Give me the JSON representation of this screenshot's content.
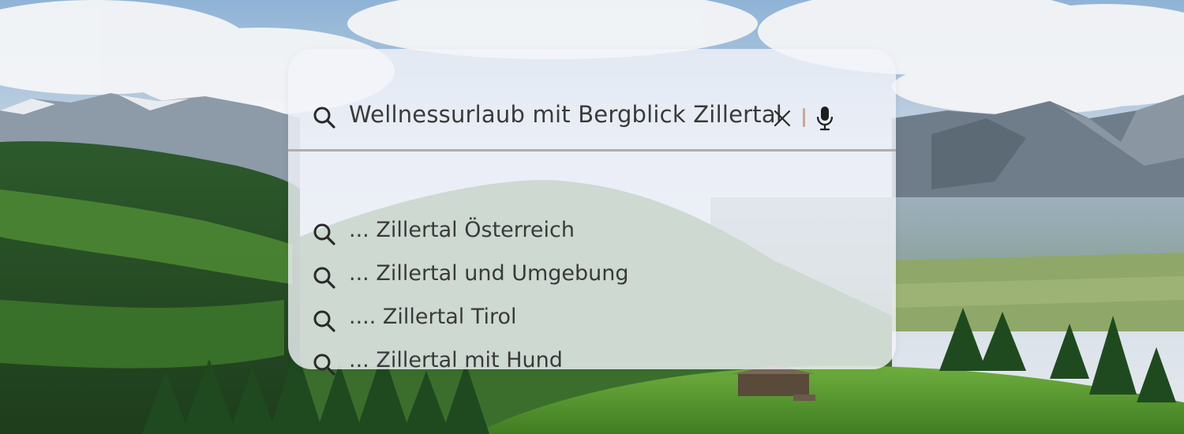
{
  "search": {
    "query": "Wellnessurlaub mit Bergblick Zillertal",
    "icon": "search-icon",
    "clear_icon": "close-icon",
    "voice_icon": "microphone-icon"
  },
  "suggestions": [
    {
      "label": "... Zillertal Österreich",
      "icon": "search-icon"
    },
    {
      "label": "... Zillertal und Umgebung",
      "icon": "search-icon"
    },
    {
      "label": ".... Zillertal Tirol",
      "icon": "search-icon"
    },
    {
      "label": "... Zillertal mit Hund",
      "icon": "search-icon"
    }
  ],
  "colors": {
    "text": "#3a3a3a",
    "divider": "#b7aca6",
    "separator": "#c8a898",
    "panel": "#f2f4fa"
  }
}
